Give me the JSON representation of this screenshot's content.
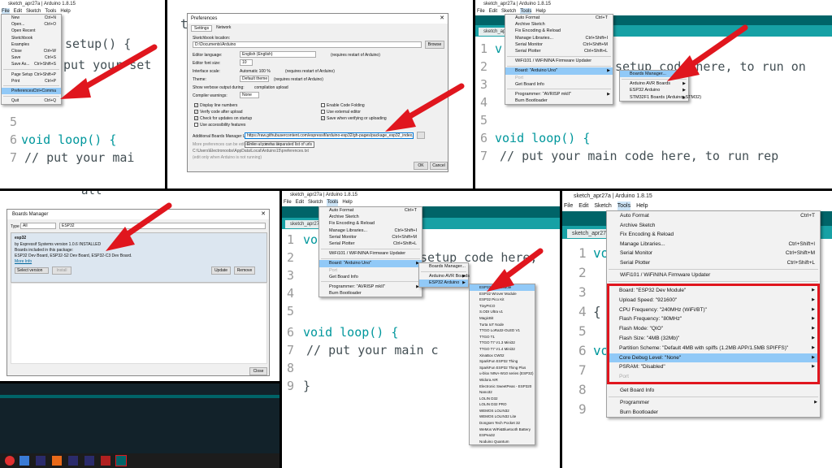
{
  "p1": {
    "title": "sketch_apr27a | Arduino 1.8.15",
    "menus": [
      "File",
      "Edit",
      "Sketch",
      "Tools",
      "Help"
    ],
    "file_menu": [
      {
        "label": "New",
        "sc": "Ctrl+N"
      },
      {
        "label": "Open...",
        "sc": "Ctrl+O"
      },
      {
        "label": "Open Recent",
        "sc": ""
      },
      {
        "label": "Sketchbook",
        "sc": ""
      },
      {
        "label": "Examples",
        "sc": ""
      },
      {
        "label": "Close",
        "sc": "Ctrl+W"
      },
      {
        "label": "Save",
        "sc": "Ctrl+S"
      },
      {
        "label": "Save As...",
        "sc": "Ctrl+Shift+S"
      },
      {
        "label": "Page Setup",
        "sc": "Ctrl+Shift+P"
      },
      {
        "label": "Print",
        "sc": "Ctrl+P"
      },
      {
        "label": "Preferences",
        "sc": "Ctrl+Comma"
      },
      {
        "label": "Quit",
        "sc": "Ctrl+Q"
      }
    ],
    "code": [
      "setup() {",
      "put your set",
      "",
      "",
      "void loop() {",
      "  // put your mai"
    ],
    "line_numbers": [
      "5",
      "6",
      "7"
    ]
  },
  "p2": {
    "extra_code": "t",
    "title": "Preferences",
    "tabs": [
      "Settings",
      "Network"
    ],
    "sketchbook_label": "Sketchbook location:",
    "sketchbook_path": "D:\\Documents\\Arduino",
    "browse": "Browse",
    "rows": [
      {
        "label": "Editor language:",
        "value": "English (English)",
        "note": "(requires restart of Arduino)"
      },
      {
        "label": "Editor font size:",
        "value": "10",
        "note": ""
      },
      {
        "label": "Interface scale:",
        "value": "Automatic  100 %",
        "note": "(requires restart of Arduino)"
      },
      {
        "label": "Theme:",
        "value": "Default theme",
        "note": "(requires restart of Arduino)"
      },
      {
        "label": "Show verbose output during:",
        "value": "compilation   upload",
        "note": ""
      },
      {
        "label": "Compiler warnings:",
        "value": "None",
        "note": ""
      }
    ],
    "checks_left": [
      "Display line numbers",
      "Verify code after upload",
      "Check for updates on startup",
      "Use accessibility features"
    ],
    "checks_right": [
      "Enable Code Folding",
      "Use external editor",
      "Save when verifying or uploading"
    ],
    "urls_label": "Additional Boards Manager URLs:",
    "urls_value": "https://raw.githubusercontent.com/espressif/arduino-esp32/gh-pages/package_esp32_index.json",
    "tooltip": "Enter a comma separated list of urls",
    "more_note": "More preferences can be edited directly in the file",
    "prefs_path": "C:\\Users\\Electronoobs\\AppData\\Local\\Arduino15\\preferences.txt",
    "edit_note": "(edit only when Arduino is not running)",
    "ok": "OK",
    "cancel": "Cancel"
  },
  "tools_menu": [
    {
      "label": "Auto Format",
      "sc": "Ctrl+T"
    },
    {
      "label": "Archive Sketch",
      "sc": ""
    },
    {
      "label": "Fix Encoding & Reload",
      "sc": ""
    },
    {
      "label": "Manage Libraries...",
      "sc": "Ctrl+Shift+I"
    },
    {
      "label": "Serial Monitor",
      "sc": "Ctrl+Shift+M"
    },
    {
      "label": "Serial Plotter",
      "sc": "Ctrl+Shift+L"
    },
    {
      "label": "WiFi101 / WiFiNINA Firmware Updater",
      "sc": ""
    },
    {
      "label": "Board: \"Arduino Uno\"",
      "sc": ""
    },
    {
      "label": "Port",
      "sc": ""
    },
    {
      "label": "Get Board Info",
      "sc": ""
    },
    {
      "label": "Programmer: \"AVRISP mkII\"",
      "sc": ""
    },
    {
      "label": "Burn Bootloader",
      "sc": ""
    }
  ],
  "p3": {
    "title": "sketch_apr27a | Arduino 1.8.15",
    "tab": "sketch_apr27a",
    "board_sub": [
      "Boards Manager...",
      "Arduino AVR Boards",
      "ESP32 Arduino",
      "STM32F1 Boards (Arduino_STM32)"
    ],
    "code": [
      "setup code here, to run on",
      "void loop() {",
      "  // put your main code here, to run rep"
    ],
    "line_numbers": [
      "1",
      "2",
      "3",
      "4",
      "5",
      "6",
      "7"
    ]
  },
  "p4": {
    "title": "Boards Manager",
    "type_label": "Type",
    "type_value": "All",
    "search": "ESP32",
    "pkg_name": "esp32",
    "pkg_by": "by Espressif Systems version 1.0.6 INSTALLED",
    "pkg_boards_label": "Boards included in this package:",
    "pkg_boards": "ESP32 Dev Board, ESP32-S2 Dev Board, ESP32-C3 Dev Board.",
    "more_info": "More Info",
    "select_version": "Select version",
    "install": "Install",
    "update": "Update",
    "remove": "Remove",
    "close": "Close",
    "code_fragment": "all"
  },
  "p5": {
    "title": "sketch_apr27a | Arduino 1.8.15",
    "tab": "sketch_apr27a",
    "board_sub": [
      "Boards Manager...",
      "Arduino AVR Boards",
      "ESP32 Arduino"
    ],
    "esp_boards": [
      "ESP32 Dev Module",
      "ESP32 Wrover Module",
      "ESP32 Pico Kit",
      "TinyPICO",
      "S.ODI Ultra v1",
      "MagicBit",
      "Turta IoT Node",
      "TTGO LoRa32-OLED V1",
      "TTGO T1",
      "TTGO T7 V1.3 Mini32",
      "TTGO T7 V1.4 Mini32",
      "XinaBox CW02",
      "SparkFun ESP32 Thing",
      "SparkFun ESP32 Thing Plus",
      "u-blox NINA-W10 series (ESP32)",
      "Widora AIR",
      "Electronic SweetPeas - ESP320",
      "Nano32",
      "LOLIN D32",
      "LOLIN D32 PRO",
      "WEMOS LOLIN32",
      "WEMOS LOLIN32 Lite",
      "Dongsen Tech Pocket 32",
      "WeMos WiFi&Bluetooth Battery",
      "ESPea32",
      "Noduino Quantum"
    ],
    "code": [
      "setup code here,",
      "void loop() {",
      "  // put your main c",
      "}"
    ],
    "line_numbers": [
      "1",
      "2",
      "3",
      "4",
      "5",
      "6",
      "7",
      "8",
      "9"
    ]
  },
  "p6": {
    "title": "sketch_apr27a | Arduino 1.8.15",
    "tab": "sketch_apr27a",
    "menu": [
      {
        "label": "Auto Format",
        "sc": "Ctrl+T"
      },
      {
        "label": "Archive Sketch",
        "sc": ""
      },
      {
        "label": "Fix Encoding & Reload",
        "sc": ""
      },
      {
        "label": "Manage Libraries...",
        "sc": "Ctrl+Shift+I"
      },
      {
        "label": "Serial Monitor",
        "sc": "Ctrl+Shift+M"
      },
      {
        "label": "Serial Plotter",
        "sc": "Ctrl+Shift+L"
      },
      {
        "label": "WiFi101 / WiFiNINA Firmware Updater",
        "sc": ""
      }
    ],
    "board_settings": [
      "Board: \"ESP32 Dev Module\"",
      "Upload Speed: \"921600\"",
      "CPU Frequency: \"240MHz (WiFi/BT)\"",
      "Flash Frequency: \"80MHz\"",
      "Flash Mode: \"QIO\"",
      "Flash Size: \"4MB (32Mb)\"",
      "Partition Scheme: \"Default 4MB with spiffs (1.2MB APP/1.5MB SPIFFS)\"",
      "Core Debug Level: \"None\"",
      "PSRAM: \"Disabled\"",
      "Port"
    ],
    "menu_tail": [
      "Get Board Info",
      "Programmer",
      "Burn Bootloader"
    ],
    "line_numbers": [
      "1",
      "2",
      "3",
      "4",
      "5",
      "6",
      "7",
      "8",
      "9"
    ],
    "code_fragments": [
      "vo",
      "{",
      "vo"
    ]
  },
  "colors": {
    "accent": "#e0161e",
    "teal": "#006468",
    "highlight": "#91c9f7"
  }
}
